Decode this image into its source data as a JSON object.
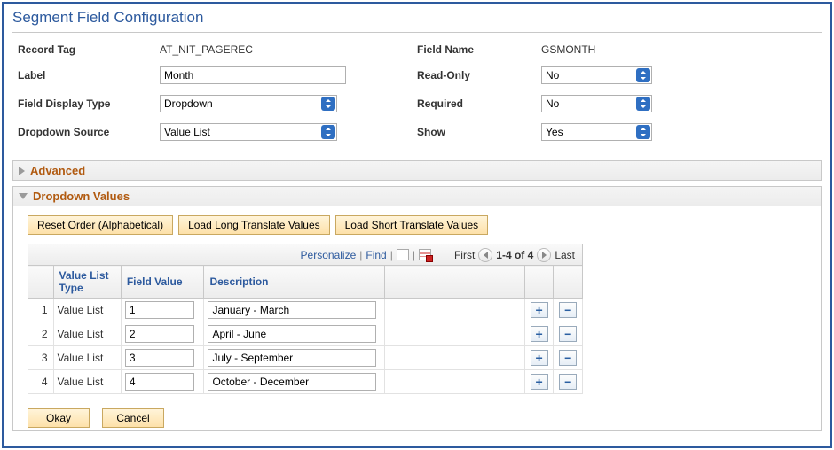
{
  "title": "Segment Field Configuration",
  "left": {
    "record_tag_label": "Record Tag",
    "record_tag_value": "AT_NIT_PAGEREC",
    "label_label": "Label",
    "label_value": "Month",
    "field_display_type_label": "Field Display Type",
    "field_display_type_value": "Dropdown",
    "dropdown_source_label": "Dropdown Source",
    "dropdown_source_value": "Value List"
  },
  "right": {
    "field_name_label": "Field Name",
    "field_name_value": "GSMONTH",
    "read_only_label": "Read-Only",
    "read_only_value": "No",
    "required_label": "Required",
    "required_value": "No",
    "show_label": "Show",
    "show_value": "Yes"
  },
  "sections": {
    "advanced": "Advanced",
    "dropdown_values": "Dropdown Values"
  },
  "buttons": {
    "reset": "Reset Order (Alphabetical)",
    "load_long": "Load Long Translate Values",
    "load_short": "Load Short Translate Values",
    "okay": "Okay",
    "cancel": "Cancel"
  },
  "grid_toolbar": {
    "personalize": "Personalize",
    "find": "Find",
    "first": "First",
    "range": "1-4 of 4",
    "last": "Last"
  },
  "grid_headers": {
    "value_list_type": "Value List Type",
    "field_value": "Field Value",
    "description": "Description"
  },
  "rows": [
    {
      "n": "1",
      "type": "Value List",
      "value": "1",
      "desc": "January - March"
    },
    {
      "n": "2",
      "type": "Value List",
      "value": "2",
      "desc": "April - June"
    },
    {
      "n": "3",
      "type": "Value List",
      "value": "3",
      "desc": "July - September"
    },
    {
      "n": "4",
      "type": "Value List",
      "value": "4",
      "desc": "October - December"
    }
  ]
}
